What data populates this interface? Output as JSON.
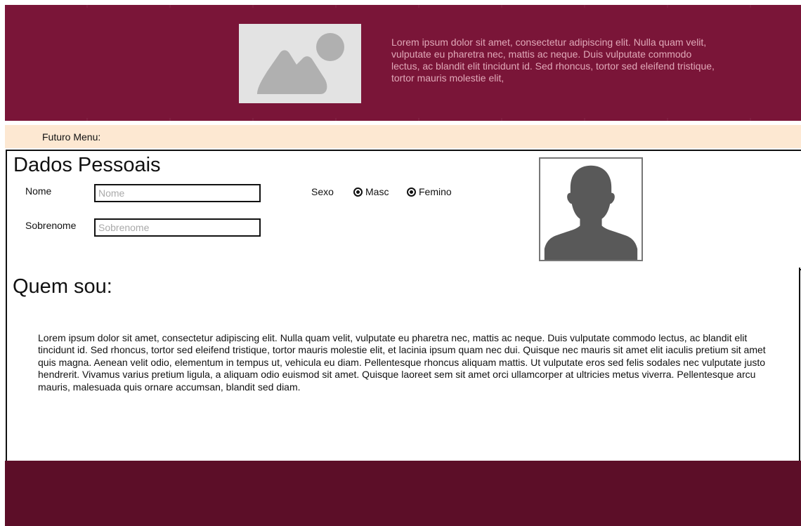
{
  "header": {
    "image_icon": "image-placeholder-icon",
    "text": "Lorem ipsum dolor sit amet, consectetur adipiscing elit. Nulla quam velit, vulputate eu pharetra nec, mattis ac neque. Duis vulputate commodo lectus, ac blandit elit tincidunt id. Sed rhoncus, tortor sed eleifend tristique, tortor mauris molestie elit,",
    "background": "#7a1538"
  },
  "menu": {
    "label": "Futuro Menu:",
    "background": "#fde8d2"
  },
  "personal": {
    "title": "Dados Pessoais",
    "nome_label": "Nome",
    "nome_placeholder": "Nome",
    "sobrenome_label": "Sobrenome",
    "sobrenome_placeholder": "Sobrenome",
    "sexo_label": "Sexo",
    "options": [
      "Masc",
      "Femino"
    ],
    "photo_icon": "user-silhouette-icon"
  },
  "about": {
    "title": "Quem sou:",
    "text": "Lorem ipsum dolor sit amet, consectetur adipiscing elit. Nulla quam velit, vulputate eu pharetra nec, mattis ac neque. Duis vulputate commodo lectus, ac blandit elit tincidunt id. Sed rhoncus, tortor sed eleifend tristique, tortor mauris molestie elit, et lacinia ipsum quam nec dui. Quisque nec mauris sit amet elit iaculis pretium sit amet quis magna. Aenean velit odio, elementum in tempus ut, vehicula eu diam. Pellentesque rhoncus aliquam mattis. Ut vulputate eros sed felis sodales nec vulputate justo hendrerit. Vivamus varius pretium ligula, a aliquam odio euismod sit amet. Quisque laoreet sem sit amet orci ullamcorper at ultricies metus viverra. Pellentesque arcu mauris, malesuada quis ornare accumsan, blandit sed diam."
  },
  "footer": {
    "background": "#5c0e28"
  }
}
